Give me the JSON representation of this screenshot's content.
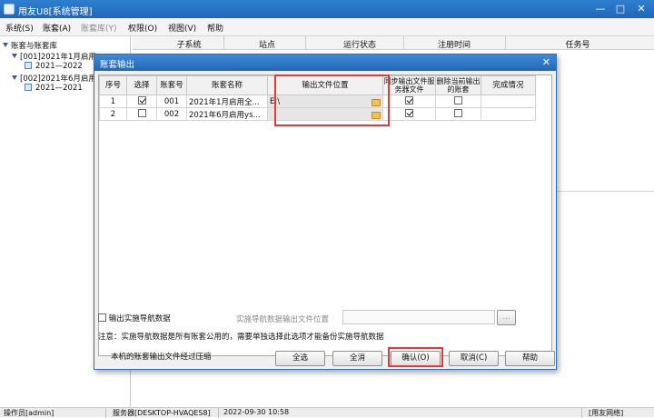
{
  "window": {
    "title": "用友U8[系统管理]"
  },
  "window_buttons": {
    "minimize": "—",
    "maximize": "□",
    "close": "✕"
  },
  "menu": [
    {
      "label": "系统(S)"
    },
    {
      "label": "账套(A)"
    },
    {
      "label": "账套库(Y)"
    },
    {
      "label": "权限(O)"
    },
    {
      "label": "视图(V)"
    },
    {
      "label": "帮助"
    }
  ],
  "tree": {
    "root": "账套与账套库",
    "accounts": [
      {
        "label": "[001]2021年1月启用",
        "child": "2021—2022"
      },
      {
        "label": "[002]2021年6月启用",
        "child": "2021—2021"
      }
    ]
  },
  "main_columns": [
    "子系统",
    "站点",
    "运行状态",
    "注册时间",
    "任务号"
  ],
  "dialog": {
    "title": "账套输出",
    "close": "✕",
    "columns": [
      "序号",
      "选择",
      "账套号",
      "账套名称",
      "输出文件位置",
      "同步输出文件服务器文件",
      "删除当前输出的账套",
      "完成情况"
    ],
    "rows": [
      {
        "index": "1",
        "selected": true,
        "code": "001",
        "name": "2021年1月启用全...",
        "path": "E:\\",
        "sync": true,
        "delete": false,
        "status": ""
      },
      {
        "index": "2",
        "selected": false,
        "code": "002",
        "name": "2021年6月启用ys...",
        "path": "",
        "sync": true,
        "delete": false,
        "status": ""
      }
    ],
    "export_nav_label": "输出实施导航数据",
    "nav_path_label": "实施导航数据输出文件位置",
    "browse_label": "...",
    "note": "注意：实施导航数据是所有账套公用的，需要单独选择此选项才能备份实施导航数据",
    "compress_note": "本机的账套输出文件经过压缩",
    "buttons": {
      "select_all": "全选",
      "clear_all": "全消",
      "confirm": "确认(O)",
      "cancel": "取消(C)",
      "help": "帮助"
    }
  },
  "status": {
    "operator": "操作员[admin]",
    "server": "服务器[DESKTOP-HVAQES8]",
    "datetime": "2022-09-30 10:58",
    "network": "[用友网络]"
  },
  "colors": {
    "title_bar": "#1e66b8",
    "highlight": "#e23a3a"
  }
}
